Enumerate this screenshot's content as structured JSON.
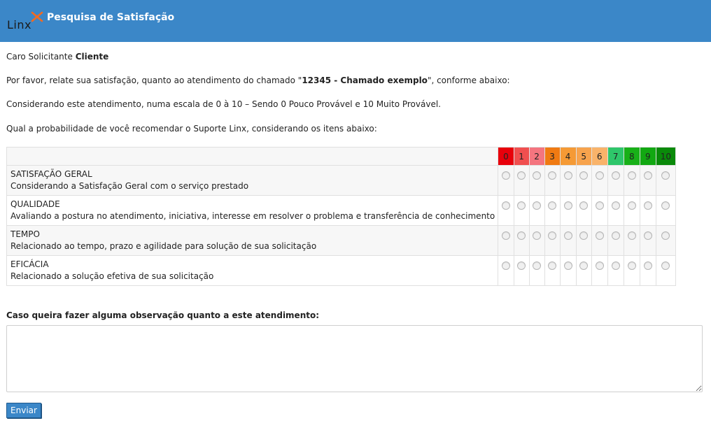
{
  "header": {
    "logo_text": "Linx",
    "title": "Pesquisa de Satisfação",
    "bg_color": "#3b87c8"
  },
  "intro": {
    "greeting_prefix": "Caro Solicitante ",
    "greeting_name": "Cliente",
    "request_prefix": "Por favor, relate sua satisfação, quanto ao atendimento do chamado \"",
    "request_ticket": "12345 - Chamado exemplo",
    "request_suffix": "\", conforme abaixo:",
    "scale_text": "Considerando este atendimento, numa escala de 0 à 10 – Sendo 0 Pouco Provável e 10 Muito Provável.",
    "question_text": "Qual a probabilidade de você recomendar o Suporte Linx, considerando os itens abaixo:"
  },
  "scale": [
    {
      "label": "0",
      "color": "#e8000b"
    },
    {
      "label": "1",
      "color": "#f04f4f"
    },
    {
      "label": "2",
      "color": "#f4757f"
    },
    {
      "label": "3",
      "color": "#f07a12"
    },
    {
      "label": "4",
      "color": "#f59a35"
    },
    {
      "label": "5",
      "color": "#f7a34d"
    },
    {
      "label": "6",
      "color": "#f9b36a"
    },
    {
      "label": "7",
      "color": "#2ec66a"
    },
    {
      "label": "8",
      "color": "#18b018"
    },
    {
      "label": "9",
      "color": "#12a812"
    },
    {
      "label": "10",
      "color": "#0a8a0a"
    }
  ],
  "items": [
    {
      "title": "SATISFAÇÃO GERAL",
      "description": "Considerando a Satisfação Geral com o serviço prestado"
    },
    {
      "title": "QUALIDADE",
      "description": "Avaliando a postura no atendimento, iniciativa, interesse em resolver o problema e transferência de conhecimento"
    },
    {
      "title": "TEMPO",
      "description": "Relacionado ao tempo, prazo e agilidade para solução de sua solicitação"
    },
    {
      "title": "EFICÁCIA",
      "description": "Relacionado a solução efetiva de sua solicitação"
    }
  ],
  "observation": {
    "label": "Caso queira fazer alguma observação quanto a este atendimento:",
    "value": ""
  },
  "submit_label": "Enviar"
}
